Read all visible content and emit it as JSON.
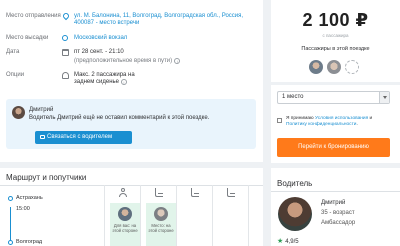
{
  "trip": {
    "departure_label": "Место отправления",
    "departure_value": "ул. М. Балонина, 11, Волгоград, Волгоградская обл., Россия, 400087 - место встречи",
    "arrival_label": "Место высадки",
    "arrival_value": "Московский вокзал",
    "date_label": "Дата",
    "date_value": "пт 28 сент. - 21:10",
    "date_note": "(предположительное время в пути)",
    "options_label": "Опции",
    "options_value": "Макс. 2 пассажира на заднем сиденье"
  },
  "driver_message": {
    "name": "Дмитрий",
    "note": "Водитель Дмитрий ещё не оставил комментарий к этой поездке.",
    "contact_button": "Связаться с водителем"
  },
  "booking": {
    "price": "2 100 ₽",
    "price_note": "с пассажира",
    "passengers_title": "Пассажиры в этой поездке",
    "seat_select_value": "1 место",
    "agree_prefix": "Я принимаю ",
    "agree_terms_link": "Условия использования",
    "agree_middle": " и ",
    "agree_privacy_link": "Политику конфиденциальности",
    "agree_suffix": ".",
    "book_button": "Перейти к бронированию"
  },
  "route": {
    "title": "Маршрут и попутчики",
    "stops": [
      {
        "name": "Астрахань",
        "time": "15:00"
      },
      {
        "name": "Волгоград",
        "time": ""
      }
    ],
    "occupied": [
      {
        "text": "Для вас: на этой стороне"
      },
      {
        "text": "Место: на этой стороне"
      }
    ]
  },
  "driver": {
    "title": "Водитель",
    "name": "Дмитрий",
    "age": "35 - возраст",
    "role": "Амбассадор",
    "rating": "4,9/5"
  },
  "colors": {
    "accent": "#1a8fd1",
    "book": "#ff7a1a",
    "occupied": "#e1f4ea",
    "rating": "#2e9e56"
  }
}
